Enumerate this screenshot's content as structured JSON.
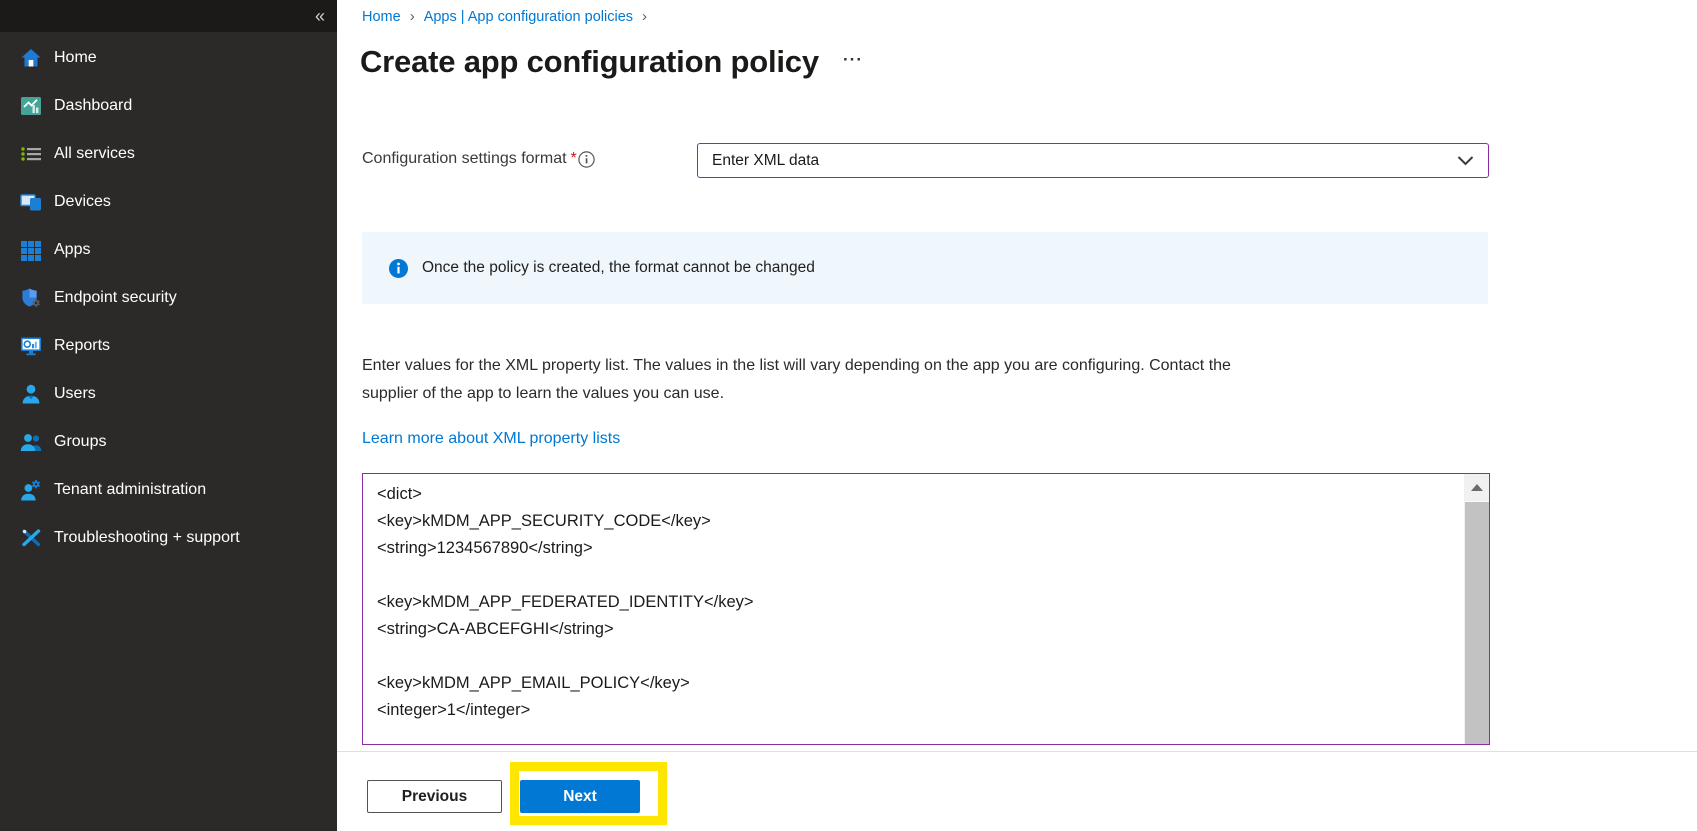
{
  "colors": {
    "accent_blue": "#0078d4",
    "visited_purple_border": "#8a2da5",
    "banner_background": "#eff6fc",
    "highlight_yellow": "#ffe600",
    "sidebar_background": "#2b2a29",
    "sidebar_topbar_background": "#1b1a19"
  },
  "sidebar": {
    "collapse_glyph": "«",
    "items": [
      {
        "label": "Home",
        "icon": "home-icon"
      },
      {
        "label": "Dashboard",
        "icon": "dashboard-icon"
      },
      {
        "label": "All services",
        "icon": "all-services-icon"
      },
      {
        "label": "Devices",
        "icon": "devices-icon"
      },
      {
        "label": "Apps",
        "icon": "apps-icon"
      },
      {
        "label": "Endpoint security",
        "icon": "endpoint-security-icon"
      },
      {
        "label": "Reports",
        "icon": "reports-icon"
      },
      {
        "label": "Users",
        "icon": "users-icon"
      },
      {
        "label": "Groups",
        "icon": "groups-icon"
      },
      {
        "label": "Tenant administration",
        "icon": "tenant-administration-icon"
      },
      {
        "label": "Troubleshooting + support",
        "icon": "troubleshooting-icon"
      }
    ]
  },
  "breadcrumb": {
    "home": "Home",
    "section": "Apps | App configuration policies",
    "separator": "›"
  },
  "page": {
    "title": "Create app configuration policy",
    "more_label": "···"
  },
  "form": {
    "settings_format_label": "Configuration settings format",
    "required_marker": "*",
    "format_value": "Enter XML data",
    "banner_text": "Once the policy is created, the format cannot be changed",
    "description_line1": "Enter values for the XML property list. The values in the list will vary depending on the app you are configuring. Contact the",
    "description_line2": "supplier of the app to learn the values you can use.",
    "learn_more_link": "Learn more about XML property lists",
    "xml_value": "<dict>\n<key>kMDM_APP_SECURITY_CODE</key>\n<string>1234567890</string>\n\n<key>kMDM_APP_FEDERATED_IDENTITY</key>\n<string>CA-ABCEFGHI</string>\n\n<key>kMDM_APP_EMAIL_POLICY</key>\n<integer>1</integer>"
  },
  "footer": {
    "previous_label": "Previous",
    "next_label": "Next"
  }
}
